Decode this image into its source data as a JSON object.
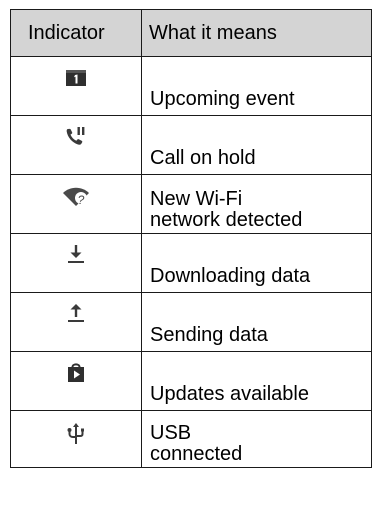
{
  "table": {
    "headers": [
      "Indicator",
      "What it means"
    ],
    "rows": [
      {
        "icon": "upcoming-event-calendar-icon",
        "meaning": [
          "Upcoming event"
        ]
      },
      {
        "icon": "call-on-hold-icon",
        "meaning": [
          "Call on hold"
        ]
      },
      {
        "icon": "new-wifi-network-icon",
        "meaning": [
          "New Wi-Fi",
          "network detected"
        ]
      },
      {
        "icon": "download-arrow-icon",
        "meaning": [
          "Downloading data"
        ]
      },
      {
        "icon": "upload-arrow-icon",
        "meaning": [
          "Sending data"
        ]
      },
      {
        "icon": "play-store-bag-icon",
        "meaning": [
          "Updates available"
        ]
      },
      {
        "icon": "usb-icon",
        "meaning": [
          "USB",
          "connected"
        ]
      }
    ]
  },
  "colors": {
    "header_bg": "#d4d4d4",
    "border": "#1a1a1a",
    "icon": "#3a3a3a"
  }
}
